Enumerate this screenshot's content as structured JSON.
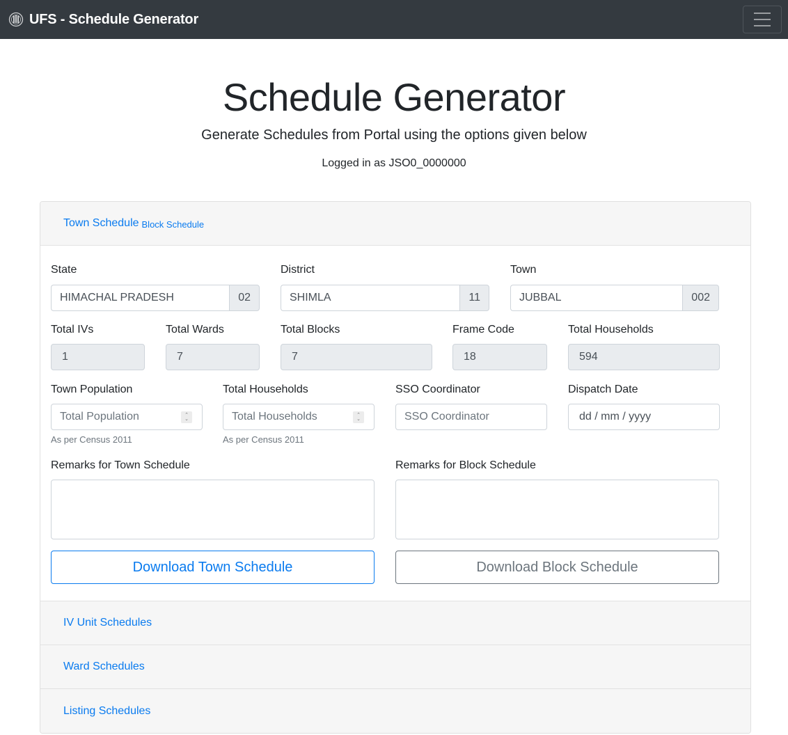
{
  "navbar": {
    "brand": "UFS - Schedule Generator",
    "logo_icon": "emblem-icon",
    "menu_icon": "hamburger-menu-icon"
  },
  "hero": {
    "title": "Schedule Generator",
    "subtitle": "Generate Schedules from Portal using the options given below",
    "login_status": "Logged in as JSO0_0000000"
  },
  "town_block_section": {
    "header_main": "Town Schedule",
    "header_sub": "Block Schedule",
    "state": {
      "label": "State",
      "value": "HIMACHAL PRADESH",
      "code": "02"
    },
    "district": {
      "label": "District",
      "value": "SHIMLA",
      "code": "11"
    },
    "town": {
      "label": "Town",
      "value": "JUBBAL",
      "code": "002"
    },
    "total_ivs": {
      "label": "Total IVs",
      "value": "1"
    },
    "total_wards": {
      "label": "Total Wards",
      "value": "7"
    },
    "total_blocks": {
      "label": "Total Blocks",
      "value": "7"
    },
    "frame_code": {
      "label": "Frame Code",
      "value": "18"
    },
    "total_households_ro": {
      "label": "Total Households",
      "value": "594"
    },
    "town_population": {
      "label": "Town Population",
      "placeholder": "Total Population",
      "help": "As per Census 2011"
    },
    "total_households_input": {
      "label": "Total Households",
      "placeholder": "Total Households",
      "help": "As per Census 2011"
    },
    "sso_coordinator": {
      "label": "SSO Coordinator",
      "placeholder": "SSO Coordinator"
    },
    "dispatch_date": {
      "label": "Dispatch Date",
      "placeholder": "dd / mm / yyyy"
    },
    "remarks_town": {
      "label": "Remarks for Town Schedule",
      "value": ""
    },
    "remarks_block": {
      "label": "Remarks for Block Schedule",
      "value": ""
    },
    "download_town_label": "Download Town Schedule",
    "download_block_label": "Download Block Schedule"
  },
  "collapsed_sections": [
    {
      "label": "IV Unit Schedules"
    },
    {
      "label": "Ward Schedules"
    },
    {
      "label": "Listing Schedules"
    }
  ],
  "colors": {
    "navbar_bg": "#343a40",
    "link": "#0a7bef",
    "secondary": "#6c757d",
    "readonly_bg": "#e9ecef",
    "header_bg": "#f6f6f6"
  }
}
